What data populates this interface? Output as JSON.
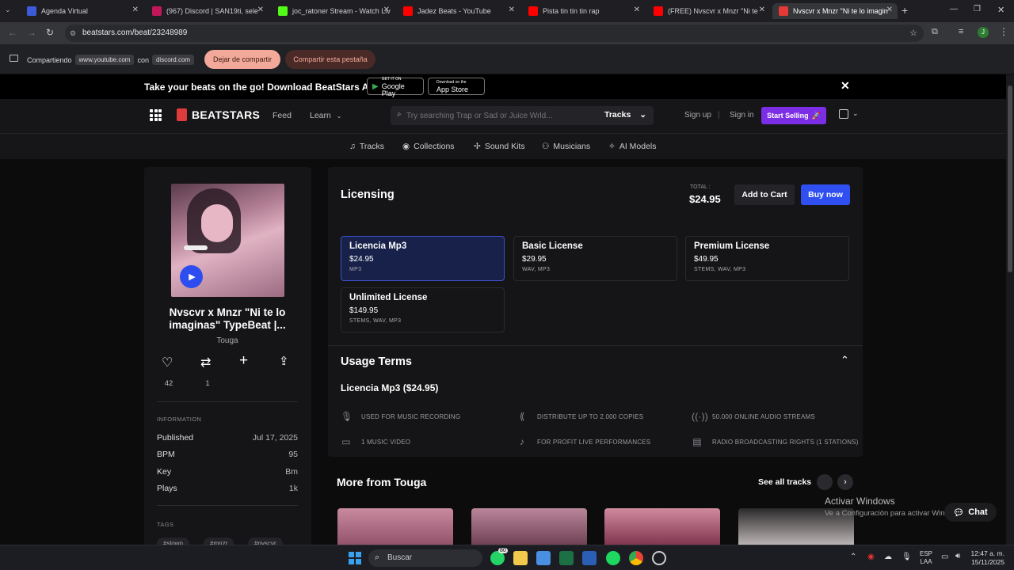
{
  "tabs": [
    {
      "title": "Agenda Virtual",
      "color": "#3b5bdb"
    },
    {
      "title": "(967) Discord | SAN19ti, sele",
      "color": "#c2185b"
    },
    {
      "title": "joc_ratoner Stream - Watch Liv",
      "color": "#53fc18"
    },
    {
      "title": "Jadez Beats - YouTube",
      "color": "#ff0000"
    },
    {
      "title": "Pista tin tin tin rap",
      "color": "#ff0000"
    },
    {
      "title": "(FREE) Nvscvr x Mnzr \"Ni te",
      "color": "#ff0000"
    },
    {
      "title": "Nvscvr x Mnzr \"Ni te lo imagin",
      "color": "#e53935"
    }
  ],
  "address": {
    "url": "beatstars.com/beat/23248989",
    "profile_initial": "J"
  },
  "sharing": {
    "label": "Compartiendo",
    "source": "www.youtube.com",
    "with": "con",
    "target": "discord.com",
    "stop_button": "Dejar de compartir",
    "share_tab_button": "Compartir esta pestaña"
  },
  "promo": {
    "text": "Take your beats on the go! Download BeatStars App",
    "google_play_small": "GET IT ON",
    "google_play": "Google Play",
    "app_store_small": "Download on the",
    "app_store": "App Store"
  },
  "nav": {
    "logo": "BEATSTARS",
    "feed": "Feed",
    "learn": "Learn",
    "search_placeholder": "Try searching Trap or Sad or Juice Wrld...",
    "search_scope": "Tracks",
    "sign_up": "Sign up",
    "sign_in": "Sign in",
    "start_selling": "Start Selling"
  },
  "subnav": [
    "Tracks",
    "Collections",
    "Sound Kits",
    "Musicians",
    "AI Models"
  ],
  "beat": {
    "title": "Nvscvr x Mnzr \"Ni te lo imaginas\" TypeBeat |...",
    "producer": "Touga",
    "likes": "42",
    "reposts": "1"
  },
  "information": {
    "heading": "INFORMATION",
    "rows": [
      {
        "label": "Published",
        "value": "Jul 17, 2025"
      },
      {
        "label": "BPM",
        "value": "95"
      },
      {
        "label": "Key",
        "value": "Bm"
      },
      {
        "label": "Plays",
        "value": "1k"
      }
    ],
    "tags_heading": "TAGS",
    "tags": [
      "#slowp",
      "#mnzr",
      "#nvscvr"
    ]
  },
  "licensing": {
    "heading": "Licensing",
    "total_label": "TOTAL :",
    "total": "$24.95",
    "add_to_cart": "Add to Cart",
    "buy_now": "Buy now",
    "licenses": [
      {
        "name": "Licencia Mp3",
        "price": "$24.95",
        "formats": "MP3"
      },
      {
        "name": "Basic License",
        "price": "$29.95",
        "formats": "WAV, MP3"
      },
      {
        "name": "Premium License",
        "price": "$49.95",
        "formats": "STEMS, WAV, MP3"
      },
      {
        "name": "Unlimited License",
        "price": "$149.95",
        "formats": "STEMS, WAV, MP3"
      }
    ]
  },
  "usage": {
    "heading": "Usage Terms",
    "selected": "Licencia Mp3 ($24.95)",
    "terms": [
      "USED FOR MUSIC RECORDING",
      "DISTRIBUTE UP TO 2.000 COPIES",
      "50.000 ONLINE AUDIO STREAMS",
      "1 MUSIC VIDEO",
      "FOR PROFIT LIVE PERFORMANCES",
      "RADIO BROADCASTING RIGHTS (1 STATIONS)"
    ]
  },
  "more": {
    "heading": "More from Touga",
    "see_all": "See all tracks"
  },
  "watermark": {
    "line1": "Activar Windows",
    "line2": "Ve a Configuración para activar Windows."
  },
  "chat": "Chat",
  "taskbar": {
    "search": "Buscar",
    "lang1": "ESP",
    "lang2": "LAA",
    "time": "12:47 a. m.",
    "date": "15/11/2025",
    "badge": "80"
  }
}
